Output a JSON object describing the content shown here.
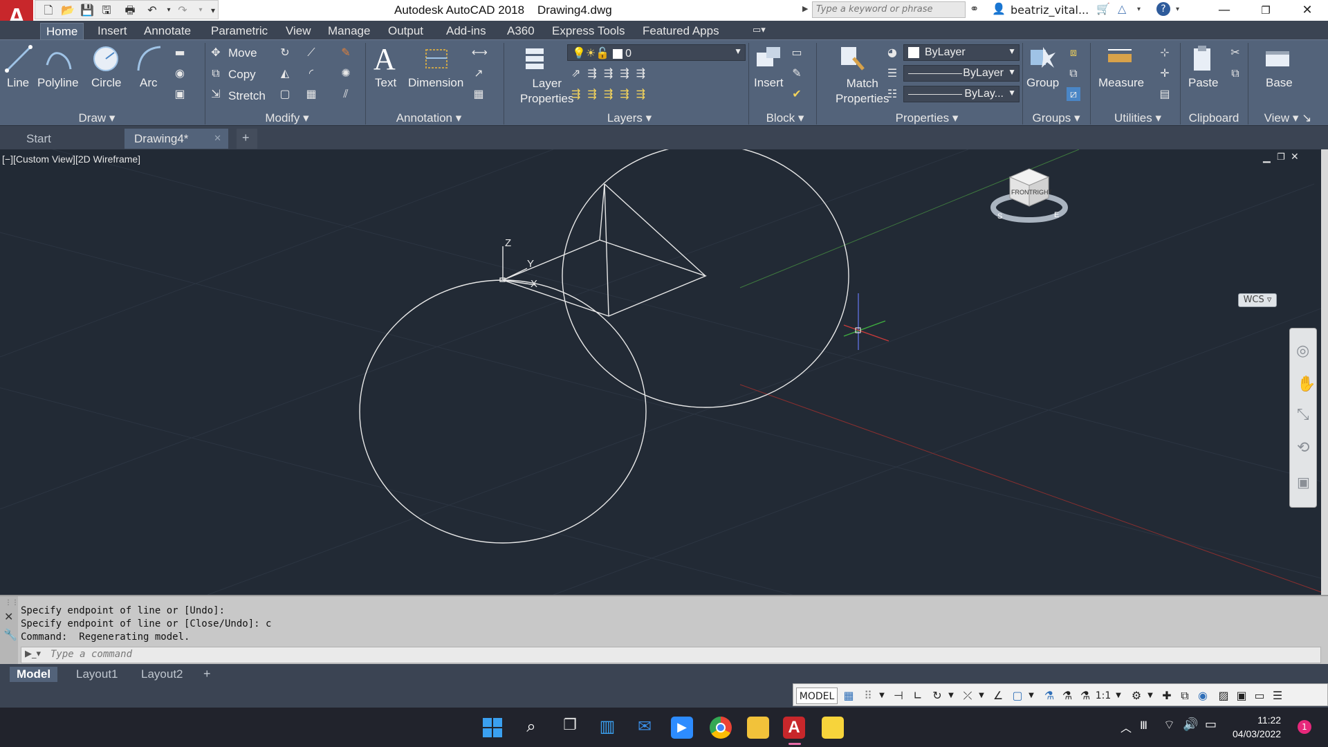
{
  "titlebar": {
    "app_title": "Autodesk AutoCAD 2018",
    "file_name": "Drawing4.dwg",
    "search_placeholder": "Type a keyword or phrase",
    "user": "beatriz_vital..."
  },
  "ribbon_tabs": [
    "Home",
    "Insert",
    "Annotate",
    "Parametric",
    "View",
    "Manage",
    "Output",
    "Add-ins",
    "A360",
    "Express Tools",
    "Featured Apps"
  ],
  "ribbon": {
    "draw": {
      "title": "Draw",
      "line": "Line",
      "polyline": "Polyline",
      "circle": "Circle",
      "arc": "Arc"
    },
    "modify": {
      "title": "Modify",
      "move": "Move",
      "copy": "Copy",
      "stretch": "Stretch"
    },
    "annotation": {
      "title": "Annotation",
      "text": "Text",
      "dimension": "Dimension"
    },
    "layers": {
      "title": "Layers",
      "layer_properties_1": "Layer",
      "layer_properties_2": "Properties",
      "current_layer": "0"
    },
    "block": {
      "title": "Block",
      "insert": "Insert"
    },
    "properties": {
      "title": "Properties",
      "match_1": "Match",
      "match_2": "Properties",
      "color": "ByLayer",
      "linetype": "ByLayer",
      "lineweight": "ByLay..."
    },
    "groups": {
      "title": "Groups",
      "group": "Group"
    },
    "utilities": {
      "title": "Utilities",
      "measure": "Measure"
    },
    "clipboard": {
      "title": "Clipboard",
      "paste": "Paste"
    },
    "view": {
      "title": "View",
      "base": "Base"
    }
  },
  "doc_tabs": {
    "start": "Start",
    "drawing": "Drawing4*",
    "new": "+"
  },
  "viewport": {
    "label": "[−][Custom View][2D Wireframe]",
    "wcs": "WCS",
    "ucs_z": "Z",
    "ucs_y": "Y",
    "ucs_x": "X",
    "cube_front": "FRONT",
    "cube_right": "RIGHT",
    "compass_s": "S",
    "compass_e": "E"
  },
  "command": {
    "history": [
      "Specify endpoint of line or [Undo]:",
      "Specify endpoint of line or [Close/Undo]: c",
      "Command:  Regenerating model."
    ],
    "placeholder": "Type a command"
  },
  "layout_tabs": [
    "Model",
    "Layout1",
    "Layout2"
  ],
  "statusbar": {
    "model": "MODEL",
    "scale": "1:1"
  },
  "taskbar": {
    "time": "11:22",
    "date": "04/03/2022",
    "notification_count": "1"
  }
}
